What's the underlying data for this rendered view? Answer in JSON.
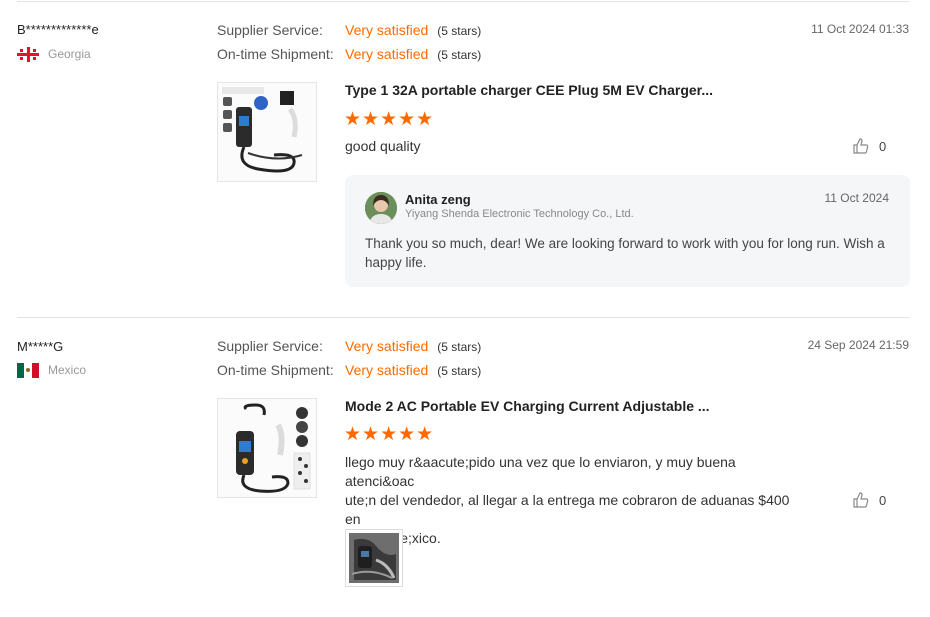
{
  "reviews": [
    {
      "buyer": "B*************e",
      "country": "Georgia",
      "flag_icon": "georgia-flag-icon",
      "date": "11 Oct 2024 01:33",
      "ratings": [
        {
          "label": "Supplier Service:",
          "value": "Very satisfied",
          "stars": "(5 stars)"
        },
        {
          "label": "On-time Shipment:",
          "value": "Very satisfied",
          "stars": "(5 stars)"
        }
      ],
      "product_title": "Type 1 32A portable charger CEE Plug 5M EV Charger...",
      "star_rating": 5,
      "stars_glyph": "★★★★★",
      "text": "good quality",
      "helpful_count": "0",
      "reply": {
        "name": "Anita zeng",
        "company": "Yiyang Shenda Electronic Technology Co., Ltd.",
        "date": "11 Oct 2024",
        "text": "Thank you so much, dear! We are looking forward to work with you for long run. Wish a happy life."
      }
    },
    {
      "buyer": "M*****G",
      "country": "Mexico",
      "flag_icon": "mexico-flag-icon",
      "date": "24 Sep 2024 21:59",
      "ratings": [
        {
          "label": "Supplier Service:",
          "value": "Very satisfied",
          "stars": "(5 stars)"
        },
        {
          "label": "On-time Shipment:",
          "value": "Very satisfied",
          "stars": "(5 stars)"
        }
      ],
      "product_title": "Mode 2 AC Portable EV Charging Current Adjustable ...",
      "star_rating": 5,
      "stars_glyph": "★★★★★",
      "text_lines": [
        "llego muy r&aacute;pido una vez que lo enviaron, y muy buena atenci&oac",
        "ute;n del vendedor, al llegar a la entrega me cobraron de aduanas $400 en",
        "M&eacute;xico."
      ],
      "helpful_count": "0"
    }
  ],
  "colors": {
    "accent": "#ff6a00",
    "divider": "#e3e3e3",
    "reply_bg": "#f5f6f8"
  }
}
